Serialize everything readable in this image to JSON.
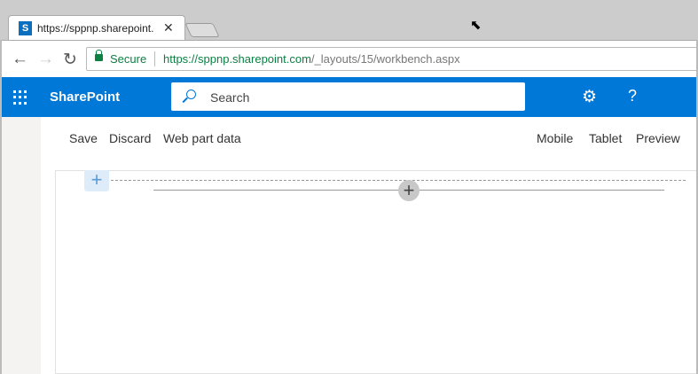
{
  "browser": {
    "tab_title": "https://sppnp.sharepoint.com",
    "tab_icon": "S",
    "secure_label": "Secure",
    "url_host": "https://sppnp.sharepoint.com",
    "url_path": "/_layouts/15/workbench.aspx"
  },
  "suite_bar": {
    "brand": "SharePoint",
    "search_placeholder": "Search",
    "accent": "#0078d7"
  },
  "toolbar": {
    "save": "Save",
    "discard": "Discard",
    "web_part_data": "Web part data",
    "mobile": "Mobile",
    "tablet": "Tablet",
    "preview": "Preview"
  }
}
